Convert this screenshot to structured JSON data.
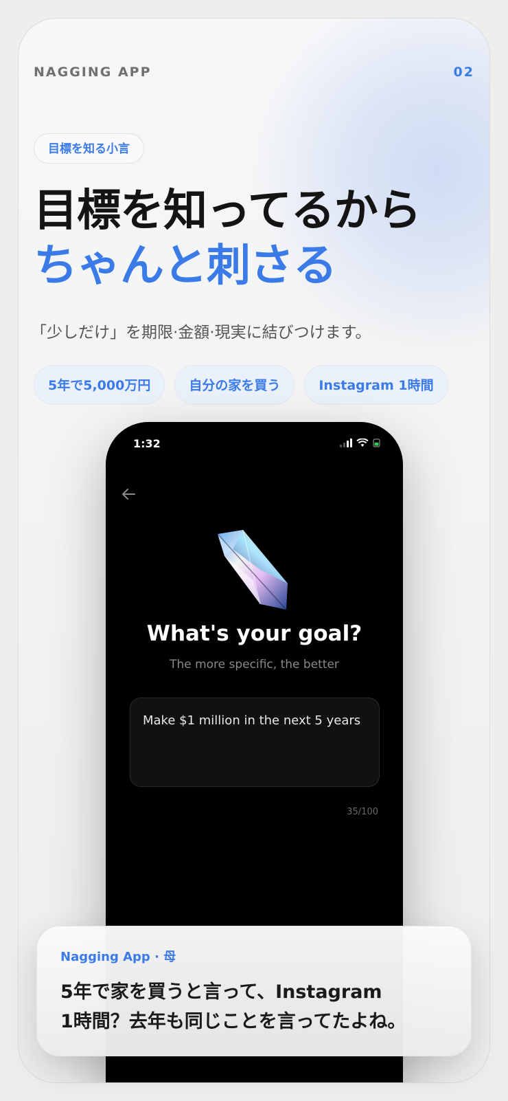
{
  "header": {
    "brand": "NAGGING APP",
    "page_number": "02"
  },
  "tag": "目標を知る小言",
  "headline": {
    "line1": "目標を知ってるから",
    "line2": "ちゃんと刺さる"
  },
  "description": "「少しだけ」を期限·金額·現実に結びつけます。",
  "pills": [
    "5年で5,000万円",
    "自分の家を買う",
    "Instagram 1時間"
  ],
  "phone": {
    "status_time": "1:32",
    "back_icon": "back-arrow-icon",
    "gem_icon": "crystal-gem-icon",
    "title": "What's your goal?",
    "subtitle": "The more specific, the better",
    "input_value": "Make $1 million in the next 5 years",
    "char_counter": "35/100"
  },
  "notification": {
    "source": "Nagging App · 母",
    "body_line1": "5年で家を買うと言って、Instagram",
    "body_line2": "1時間？去年も同じことを言ってたよね。"
  },
  "colors": {
    "accent": "#3b7be8",
    "heading": "#141414",
    "phone_bg": "#000000"
  }
}
